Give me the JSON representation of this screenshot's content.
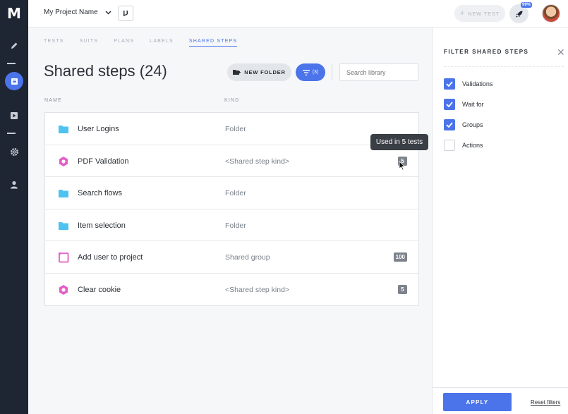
{
  "app": {
    "logo": "M"
  },
  "nav": [
    {
      "icon": "pencil-icon"
    },
    {
      "icon": "list-icon",
      "active": true
    },
    {
      "icon": "play-icon"
    },
    {
      "icon": "gear-icon"
    },
    {
      "icon": "user-icon"
    }
  ],
  "topbar": {
    "project_name": "My Project Name",
    "new_test": "NEW TEST",
    "rocket_badge": "99%"
  },
  "tabs": [
    "TESTS",
    "SUITS",
    "PLANS",
    "LABELS",
    "SHARED STEPS"
  ],
  "active_tab": "SHARED STEPS",
  "page_title": "Shared steps (24)",
  "toolbar": {
    "new_folder": "NEW FOLDER",
    "filter_count": "(3)",
    "search_placeholder": "Search library"
  },
  "columns": {
    "name": "NAME",
    "kind": "KIND"
  },
  "rows": [
    {
      "icon": "folder-icon",
      "name": "User Logins",
      "kind": "Folder",
      "badge": ""
    },
    {
      "icon": "hexagon-icon",
      "name": "PDF Validation",
      "kind": "<Shared step kind>",
      "badge": "5"
    },
    {
      "icon": "folder-icon",
      "name": "Search flows",
      "kind": "Folder",
      "badge": ""
    },
    {
      "icon": "folder-icon",
      "name": "Item selection",
      "kind": "Folder",
      "badge": ""
    },
    {
      "icon": "group-icon",
      "name": "Add user to project",
      "kind": "Shared group",
      "badge": "100"
    },
    {
      "icon": "hexagon-icon",
      "name": "Clear cookie",
      "kind": "<Shared step kind>",
      "badge": "5"
    }
  ],
  "tooltip": "Used in 5 tests",
  "filter_panel": {
    "title": "FILTER SHARED STEPS",
    "options": [
      {
        "label": "Validations",
        "checked": true
      },
      {
        "label": "Wait for",
        "checked": true
      },
      {
        "label": "Groups",
        "checked": true
      },
      {
        "label": "Actions",
        "checked": false
      }
    ],
    "apply": "APPLY",
    "reset": "Reset filters"
  },
  "colors": {
    "accent": "#4b74ea",
    "folder": "#4fc3f0",
    "shared_step": "#e25fc8",
    "nav_bg": "#1e2533"
  }
}
